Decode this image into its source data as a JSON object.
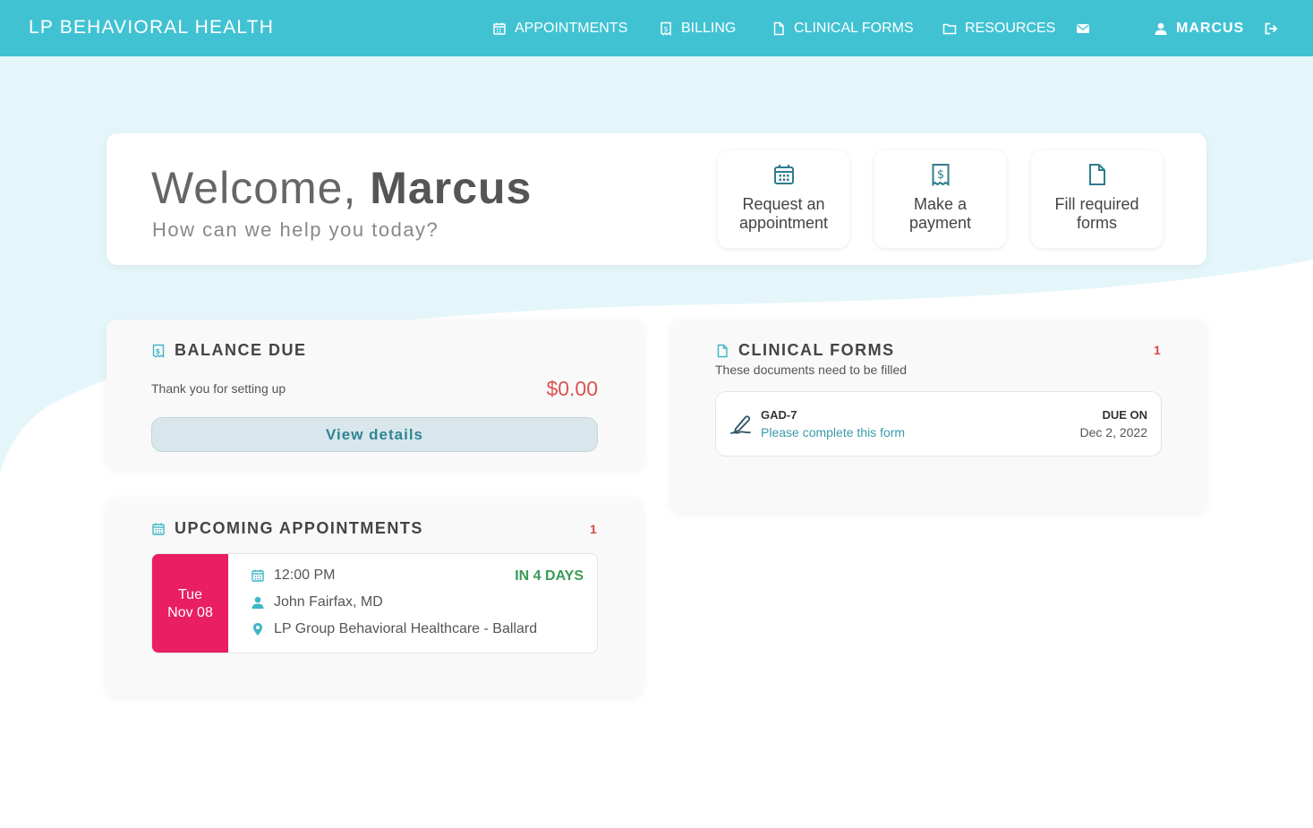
{
  "brand": "LP BEHAVIORAL HEALTH",
  "nav": {
    "appointments": "APPOINTMENTS",
    "billing": "BILLING",
    "clinical_forms": "CLINICAL FORMS",
    "resources": "RESOURCES",
    "user": "MARCUS"
  },
  "welcome": {
    "greeting": "Welcome,",
    "name": "Marcus",
    "subtitle": "How can we help you today?"
  },
  "quick_actions": {
    "appointment": [
      "Request an",
      "appointment"
    ],
    "payment": [
      "Make a",
      "payment"
    ],
    "forms": [
      "Fill required",
      "forms"
    ]
  },
  "balance": {
    "title": "BALANCE DUE",
    "message": "Thank you for setting up",
    "amount": "$0.00",
    "button": "View details"
  },
  "appointments": {
    "title": "UPCOMING APPOINTMENTS",
    "count": "1",
    "items": [
      {
        "day": "Tue",
        "date": "Nov 08",
        "time": "12:00 PM",
        "relative": "IN 4 DAYS",
        "provider": "John Fairfax, MD",
        "location": "LP Group Behavioral Healthcare - Ballard"
      }
    ]
  },
  "clinical_forms": {
    "title": "CLINICAL FORMS",
    "count": "1",
    "subtitle": "These documents need to be filled",
    "items": [
      {
        "name": "GAD-7",
        "action": "Please complete this form",
        "due_label": "DUE ON",
        "due_date": "Dec 2, 2022"
      }
    ]
  },
  "colors": {
    "header": "#41c2d3",
    "wave": "#e5f6fa",
    "date_badge": "#e91e63",
    "amount": "#d9534f",
    "relative": "#3a9a57",
    "link": "#3a9aaa"
  }
}
